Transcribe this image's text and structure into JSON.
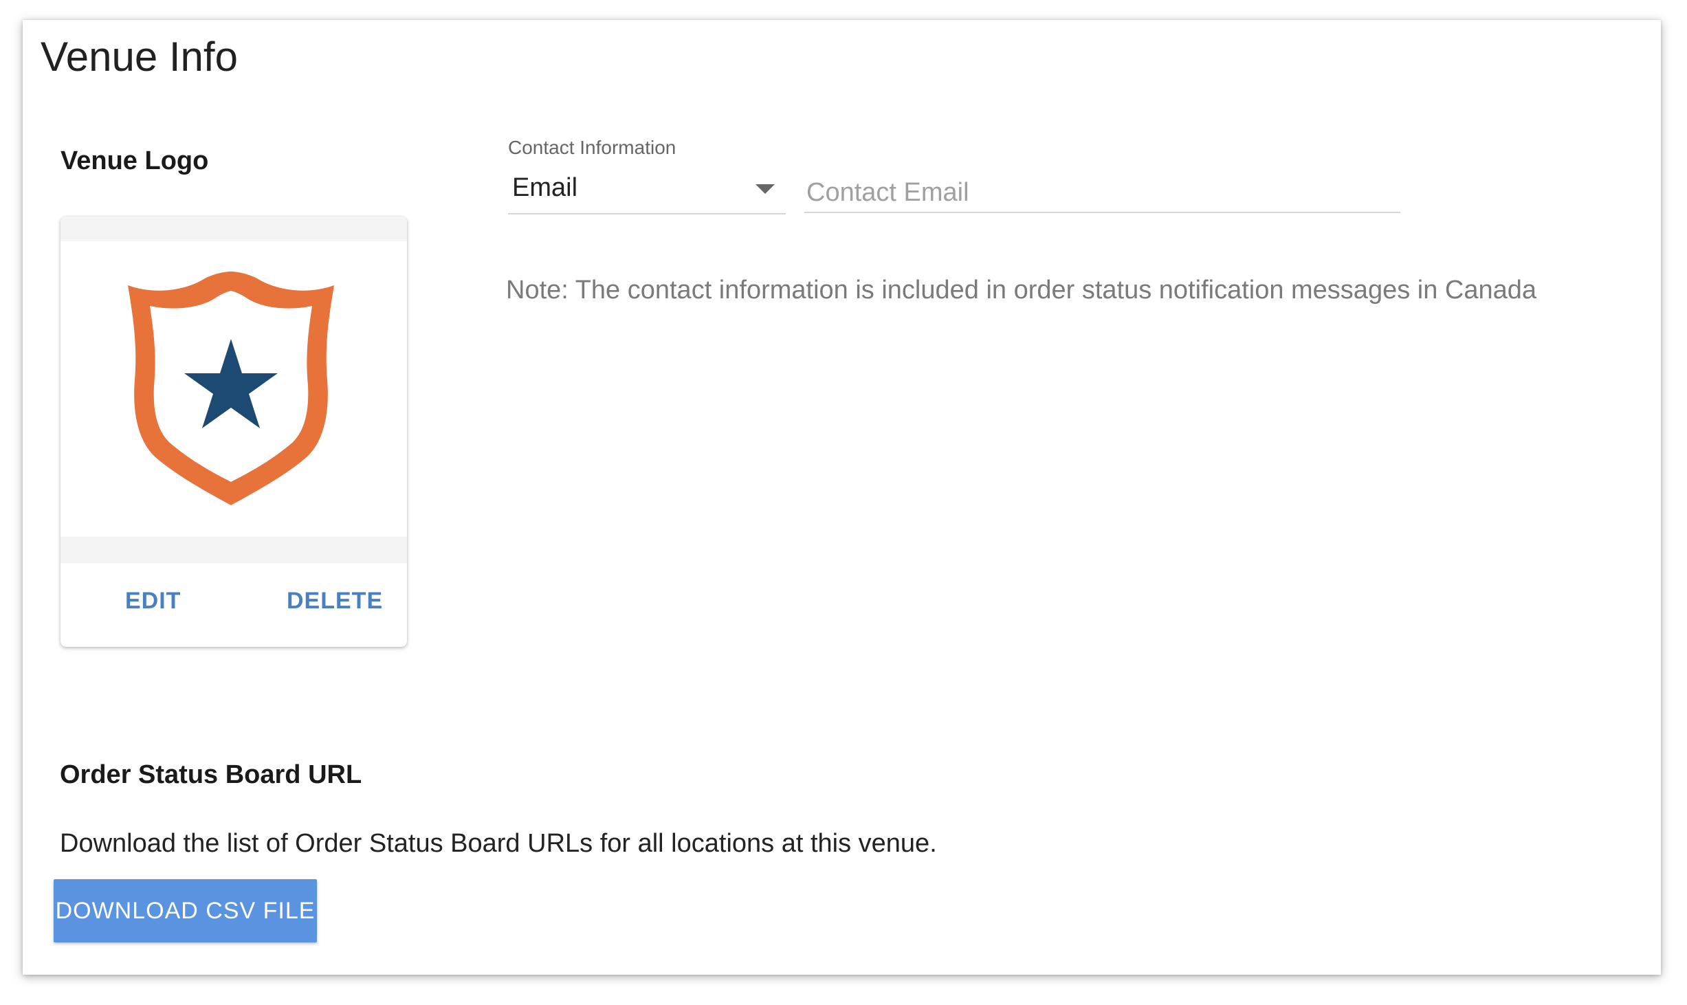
{
  "page": {
    "title": "Venue Info"
  },
  "venue_logo": {
    "heading": "Venue Logo",
    "edit_label": "EDIT",
    "delete_label": "DELETE",
    "logo_icon": "shield-star-icon",
    "colors": {
      "shield": "#e8733a",
      "star": "#1c4a72"
    }
  },
  "contact": {
    "label": "Contact Information",
    "type_value": "Email",
    "email_placeholder": "Contact Email",
    "email_value": "",
    "note": "Note: The contact information is included in order status notification messages in Canada"
  },
  "order_status_board": {
    "heading": "Order Status Board URL",
    "description": "Download the list of Order Status Board URLs for all locations at this venue.",
    "download_label": "DOWNLOAD CSV FILE",
    "button_color": "#5a93e0"
  }
}
